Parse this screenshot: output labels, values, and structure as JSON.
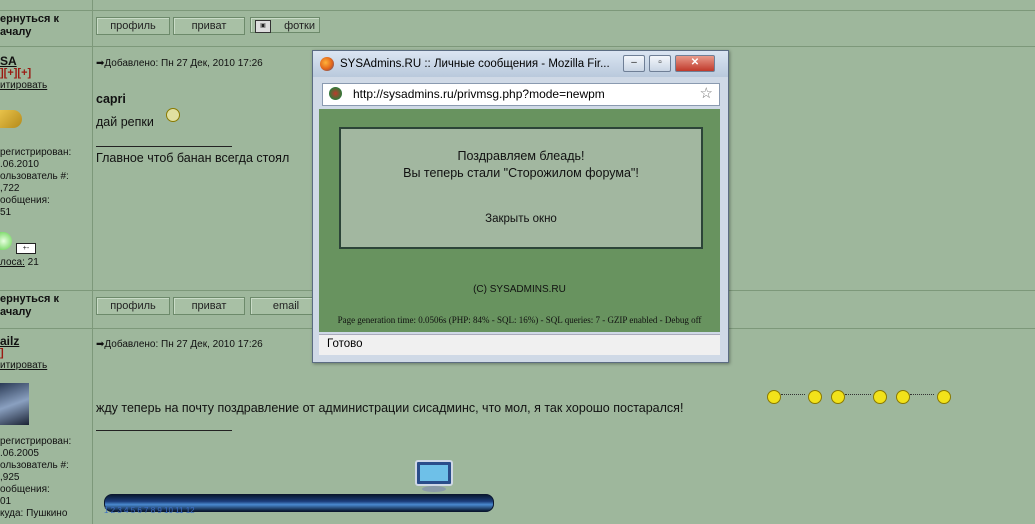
{
  "row1": {
    "goto_label": "ернуться к\nачалу",
    "buttons": [
      "профиль",
      "приват",
      "фотки"
    ]
  },
  "post1": {
    "user": {
      "name": "SA",
      "rank": "][+][+]",
      "quote_link": "итировать",
      "registered_label": "регистрирован:",
      "registered_date": ".06.2010",
      "user_no_label": "ользователь #:",
      "user_no": ",722",
      "messages_label": "ообщения:",
      "messages": "51",
      "votes_label": "лоса:",
      "votes": "21"
    },
    "header": "Добавлено: Пн 27 Дек, 2010 17:26",
    "author_bold": "capri",
    "body": "дай репки",
    "signature": "Главное чтоб банан всегда стоял"
  },
  "row2": {
    "goto_label": "ернуться к\nачалу",
    "buttons": [
      "профиль",
      "приват",
      "email"
    ]
  },
  "post2": {
    "user": {
      "name": "ailz",
      "rank": "]",
      "quote_link": "итировать",
      "registered_label": "регистрирован:",
      "registered_date": ".06.2005",
      "user_no_label": "ользователь #:",
      "user_no": ",925",
      "messages_label": "ообщения:",
      "messages": "01",
      "from_label": "куда:",
      "from": "Пушкино"
    },
    "header": "Добавлено: Пн 27 Дек, 2010 17:26",
    "body": "жду теперь на почту поздравление от администрации сисадминс, что мол, я так хорошо постарался!"
  },
  "popup": {
    "title": "SYSAdmins.RU :: Личные сообщения - Mozilla Fir...",
    "url": "http://sysadmins.ru/privmsg.php?mode=newpm",
    "message_line1": "Поздравляем блеадь!",
    "message_line2": "Вы теперь стали \"Сторожилом форума\"!",
    "close_link": "Закрыть окно",
    "copyright": "(C) SYSADMINS.RU",
    "gen_info": "Page generation time: 0.0506s (PHP: 84% - SQL: 16%) - SQL queries: 7 - GZIP enabled - Debug off",
    "status": "Готово"
  },
  "dock": {
    "numbers": "1    2    3    4    5    6    7    8    9    10    11    12"
  },
  "colors": {
    "page_bg": "#9eb79c",
    "popup_content_bg": "#68935f",
    "rank": "#9b1a12"
  }
}
